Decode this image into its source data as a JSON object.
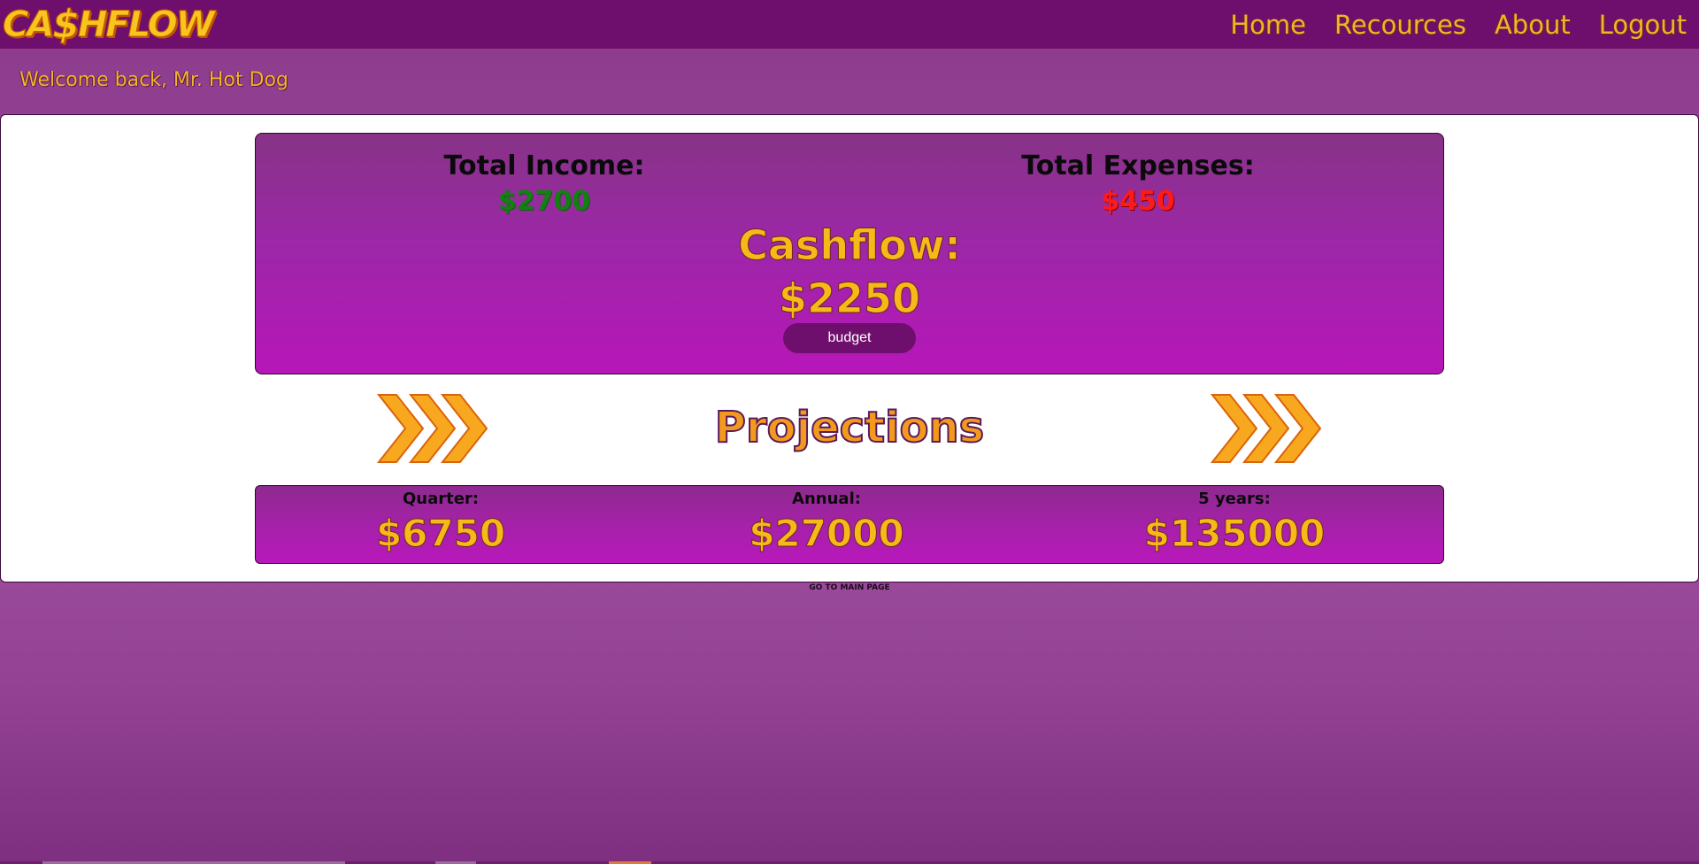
{
  "brand": {
    "logo_text": "CA",
    "logo_dollar": "$",
    "logo_rest": "HFLOW"
  },
  "nav": {
    "items": [
      {
        "label": "Home"
      },
      {
        "label": "Recources"
      },
      {
        "label": "About"
      },
      {
        "label": "Logout"
      }
    ]
  },
  "welcome": "Welcome back, Mr. Hot Dog",
  "summary": {
    "income_label": "Total Income:",
    "income_value": "$2700",
    "expenses_label": "Total Expenses:",
    "expenses_value": "$450",
    "cashflow_label": "Cashflow:",
    "cashflow_value": "$2250",
    "budget_button": "budget"
  },
  "projections": {
    "title": "Projections",
    "quarter_label": "Quarter:",
    "quarter_value": "$6750",
    "annual_label": "Annual:",
    "annual_value": "$27000",
    "five_year_label": "5 years:",
    "five_year_value": "$135000"
  },
  "footer_link": "GO TO MAIN PAGE",
  "colors": {
    "navbar": "#6f0f6d",
    "accent_gold": "#f7b81a",
    "income_green": "#128012",
    "expense_red": "#ff1a1a",
    "arrow_orange": "#f29a1e"
  }
}
